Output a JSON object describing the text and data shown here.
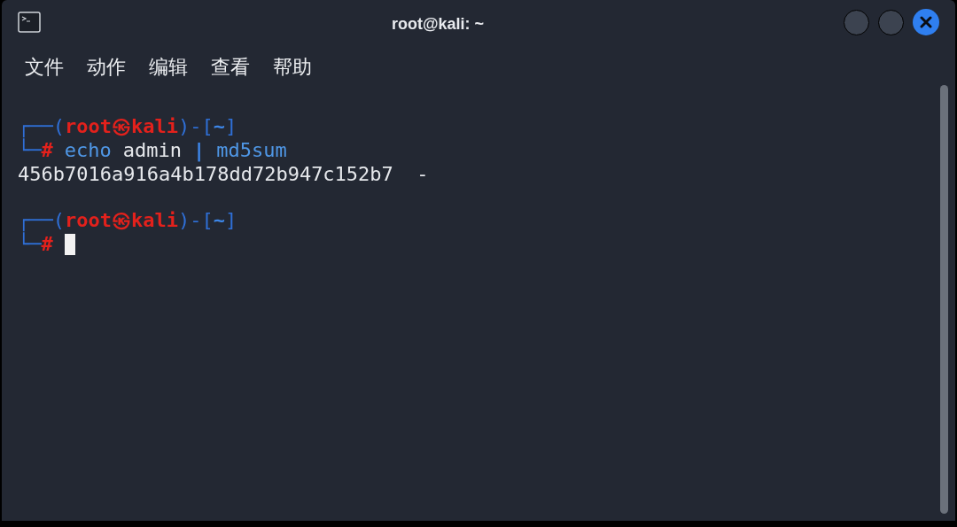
{
  "window": {
    "title": "root@kali: ~"
  },
  "menu": [
    {
      "label": "文件"
    },
    {
      "label": "动作"
    },
    {
      "label": "编辑"
    },
    {
      "label": "查看"
    },
    {
      "label": "帮助"
    }
  ],
  "terminal": {
    "lines": [
      {
        "kind": "prompt",
        "segments": [
          {
            "kind": "frame",
            "text": "┌──("
          },
          {
            "kind": "user",
            "text": "root㉿kali"
          },
          {
            "kind": "frame",
            "text": ")-["
          },
          {
            "kind": "path",
            "text": "~"
          },
          {
            "kind": "frame",
            "text": "]"
          }
        ]
      },
      {
        "kind": "prompt",
        "segments": [
          {
            "kind": "frame",
            "text": "└─"
          },
          {
            "kind": "hash",
            "text": "#"
          },
          {
            "kind": "command",
            "text": "echo"
          },
          {
            "kind": "argument",
            "text": "admin"
          },
          {
            "kind": "pipe",
            "text": "|"
          },
          {
            "kind": "command",
            "text": "md5sum"
          }
        ]
      },
      {
        "kind": "output",
        "segments": [
          {
            "kind": "plain",
            "text": "456b7016a916a4b178dd72b947c152b7  -"
          }
        ]
      },
      {
        "kind": "blank"
      },
      {
        "kind": "prompt",
        "segments": [
          {
            "kind": "frame",
            "text": "┌──("
          },
          {
            "kind": "user",
            "text": "root㉿kali"
          },
          {
            "kind": "frame",
            "text": ")-["
          },
          {
            "kind": "path",
            "text": "~"
          },
          {
            "kind": "frame",
            "text": "]"
          }
        ]
      },
      {
        "kind": "prompt",
        "segments": [
          {
            "kind": "frame",
            "text": "└─"
          },
          {
            "kind": "hash",
            "text": "#"
          },
          {
            "kind": "cursor"
          }
        ]
      }
    ]
  }
}
